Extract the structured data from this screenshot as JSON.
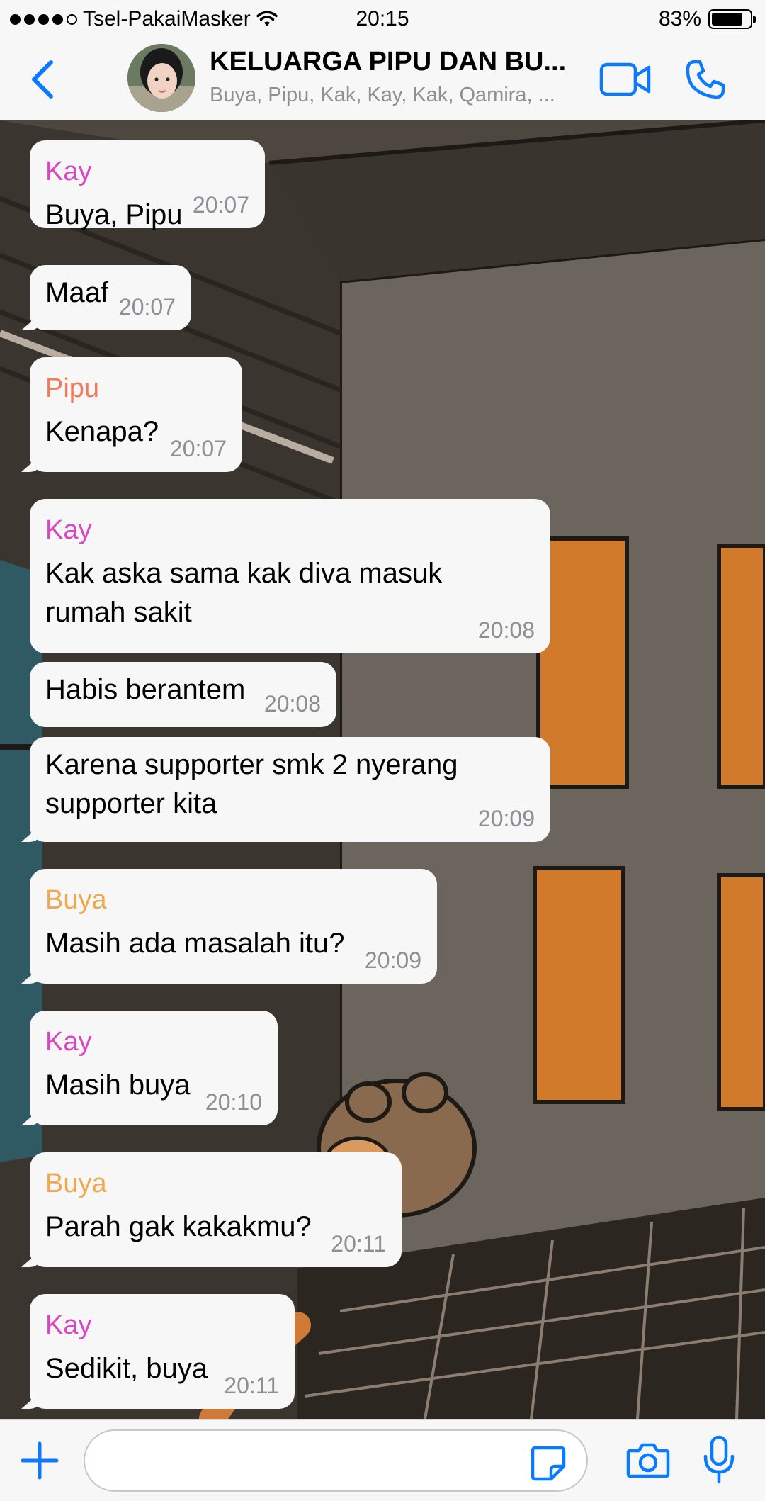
{
  "status_bar": {
    "carrier": "Tsel-PakaiMasker",
    "time": "20:15",
    "battery": "83%",
    "battery_level": 0.83
  },
  "header": {
    "title": "KELUARGA PIPU DAN BU...",
    "subtitle": "Buya, Pipu, Kak, Kay, Kak, Qamira, ...",
    "icons": [
      "back-chevron-icon",
      "video-call-icon",
      "phone-call-icon"
    ]
  },
  "colors": {
    "accent": "#0a7aff",
    "kay": "#d946c4",
    "pipu": "#f07a5a",
    "buya": "#f0a850",
    "bubble": "#f7f7f7",
    "timestamp": "#8e8e93"
  },
  "messages": [
    {
      "sender": "Kay",
      "text": "Buya, Pipu",
      "time": "20:07"
    },
    {
      "sender": "",
      "text": "Maaf",
      "time": "20:07"
    },
    {
      "sender": "Pipu",
      "text": "Kenapa?",
      "time": "20:07"
    },
    {
      "sender": "Kay",
      "text": "Kak aska sama kak diva masuk",
      "text2": "rumah sakit",
      "time": "20:08"
    },
    {
      "sender": "",
      "text": "Habis berantem",
      "time": "20:08"
    },
    {
      "sender": "",
      "text": "Karena supporter smk 2 nyerang",
      "text2": "supporter kita",
      "time": "20:09"
    },
    {
      "sender": "Buya",
      "text": "Masih ada masalah itu?",
      "time": "20:09"
    },
    {
      "sender": "Kay",
      "text": "Masih buya",
      "time": "20:10"
    },
    {
      "sender": "Buya",
      "text": "Parah gak kakakmu?",
      "time": "20:11"
    },
    {
      "sender": "Kay",
      "text": "Sedikit, buya",
      "time": "20:11"
    }
  ],
  "input_bar": {
    "icons": [
      "plus-icon",
      "sticker-icon",
      "camera-icon",
      "microphone-icon"
    ],
    "message_value": ""
  }
}
